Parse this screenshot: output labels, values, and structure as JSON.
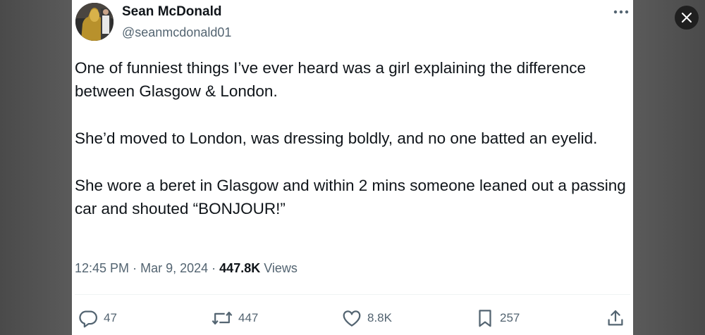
{
  "author": {
    "name": "Sean McDonald",
    "handle": "@seanmcdonald01"
  },
  "tweet": {
    "paragraphs": [
      "One of funniest things I’ve ever heard was a girl explaining the difference between Glasgow & London.",
      "She’d moved to London, was dressing boldly, and no one batted an eyelid.",
      "She wore a beret in Glasgow and within 2 mins someone leaned out a passing car and shouted “BONJOUR!”"
    ],
    "time": "12:45 PM",
    "separator": "·",
    "date": "Mar 9, 2024",
    "views_count": "447.8K",
    "views_label": "Views"
  },
  "actions": {
    "replies": "47",
    "reposts": "447",
    "likes": "8.8K",
    "bookmarks": "257"
  },
  "icons": {
    "close": "close-icon",
    "more": "more-horizontal-icon",
    "reply": "reply-icon",
    "repost": "repost-icon",
    "like": "heart-icon",
    "bookmark": "bookmark-icon",
    "share": "share-icon"
  },
  "colors": {
    "text": "#0f1419",
    "secondary": "#536471",
    "backdrop": "#555555",
    "close_bg": "#1f1f1f"
  }
}
